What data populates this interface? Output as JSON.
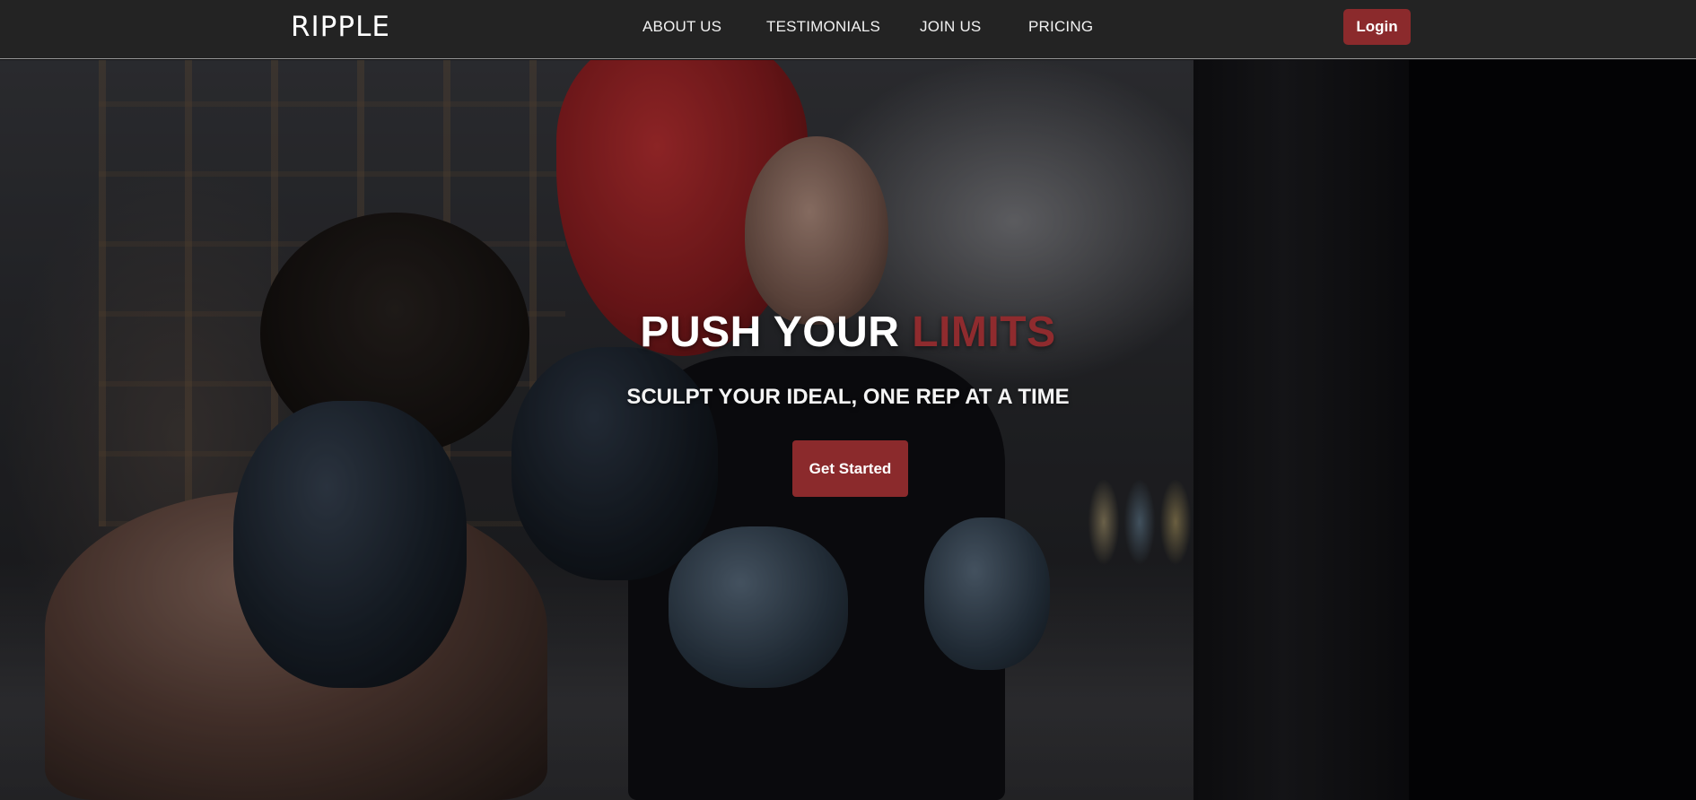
{
  "navbar": {
    "brand": "RIPPLE",
    "links": [
      "ABOUT US",
      "TESTIMONIALS",
      "JOIN US",
      "PRICING"
    ],
    "login_label": "Login"
  },
  "hero": {
    "title_main": "PUSH YOUR ",
    "title_accent": "LIMITS",
    "subtitle": "SCULPT YOUR IDEAL, ONE REP AT A TIME",
    "cta_label": "Get Started",
    "background_image": "boxing-gym-training-photo"
  },
  "colors": {
    "accent": "#8b2a2c",
    "navbar_bg": "#232323",
    "text": "#ffffff"
  }
}
